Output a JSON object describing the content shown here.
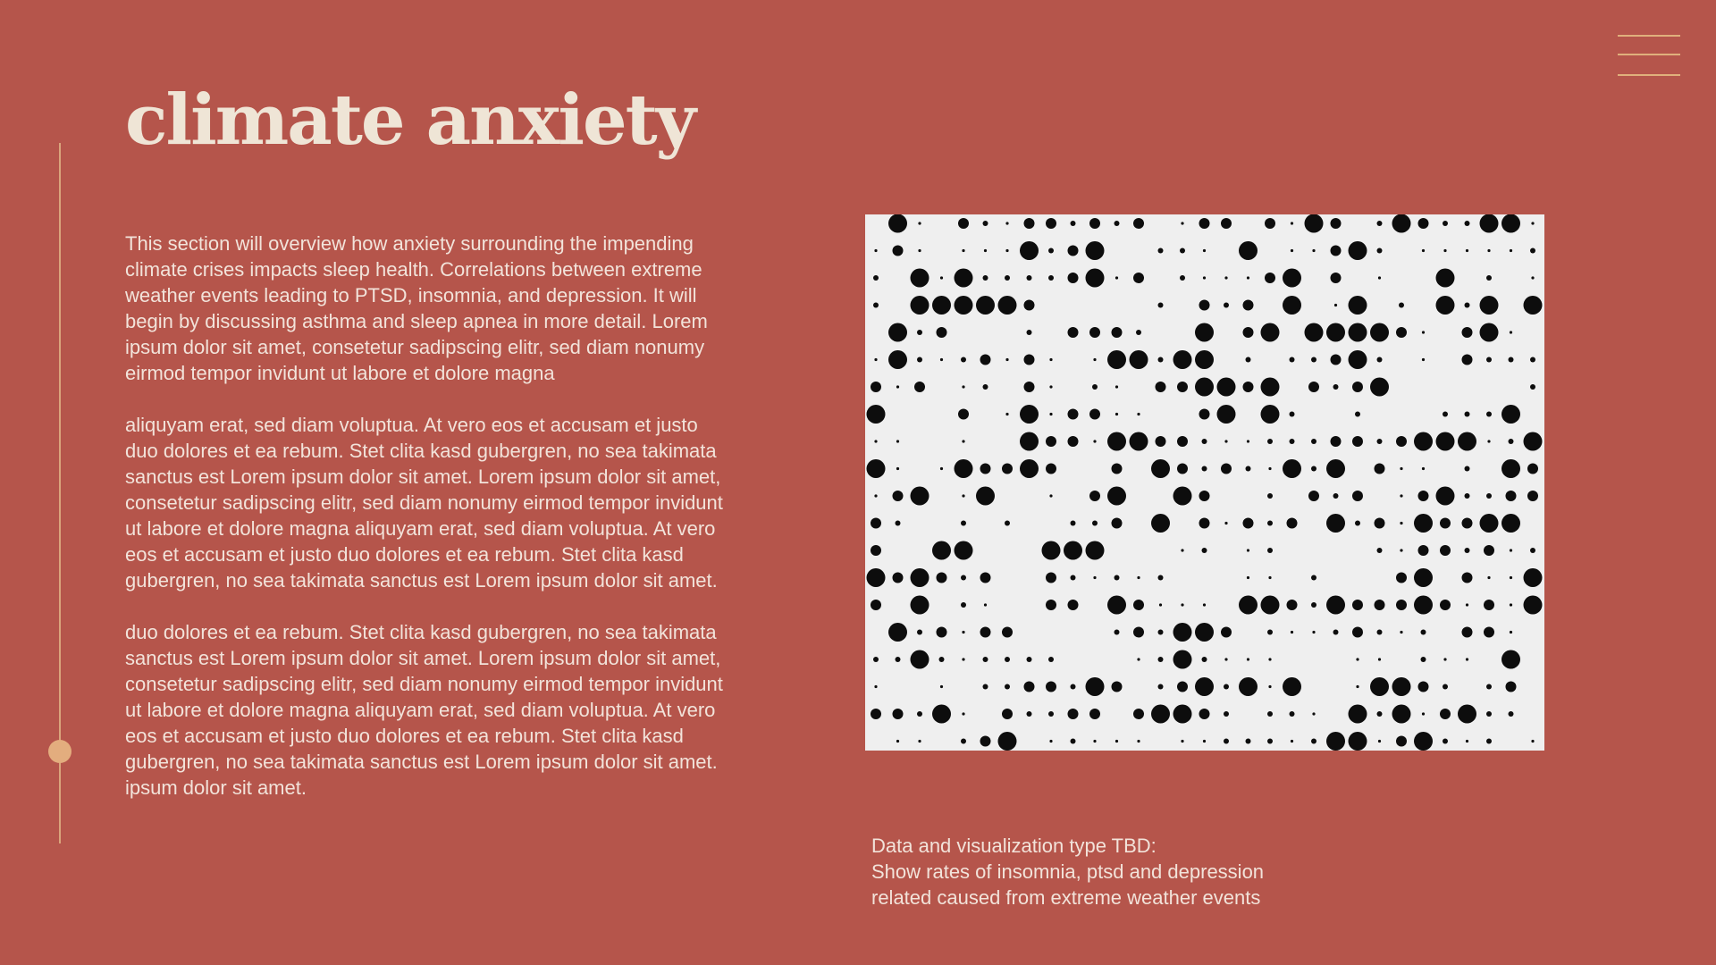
{
  "title": "climate anxiety",
  "paragraphs": [
    "This section will overview how anxiety surrounding the impending climate crises impacts sleep health. Correlations between extreme weather events leading to PTSD, insomnia, and depression. It will begin by discussing asthma and sleep apnea in more detail. Lorem ipsum dolor sit amet, consetetur sadipscing elitr, sed diam nonumy eirmod tempor invidunt ut labore et dolore magna",
    "aliquyam erat, sed diam voluptua. At vero eos et accusam et justo duo dolores et ea rebum. Stet clita kasd gubergren, no sea takimata sanctus est Lorem ipsum dolor sit amet. Lorem ipsum dolor sit amet, consetetur sadipscing elitr, sed diam nonumy eirmod tempor invidunt ut labore et dolore magna aliquyam erat, sed diam voluptua. At vero eos et accusam et justo duo dolores et ea rebum. Stet clita kasd gubergren, no sea takimata sanctus est Lorem ipsum dolor sit amet.",
    "duo dolores et ea rebum. Stet clita kasd gubergren, no sea takimata sanctus est Lorem ipsum dolor sit amet. Lorem ipsum dolor sit amet, consetetur sadipscing elitr, sed diam nonumy eirmod tempor invidunt ut labore et dolore magna aliquyam erat, sed diam voluptua. At vero eos et accusam et justo duo dolores et ea rebum. Stet clita kasd gubergren, no sea takimata sanctus est Lorem ipsum dolor sit amet. ipsum dolor sit amet."
  ],
  "caption": {
    "line1": "Data and visualization type TBD:",
    "line2": "Show rates of insomnia, ptsd  and depression",
    "line3": "related caused from extreme weather events"
  },
  "icons": {
    "menu": "hamburger-menu-icon",
    "timeline": "timeline-slider"
  },
  "colors": {
    "background": "#b5554b",
    "title": "#efe5d6",
    "text": "#f2e3da",
    "accent": "#e0b07c",
    "figure_background": "#efefef",
    "dots": "#0d0d0d"
  }
}
